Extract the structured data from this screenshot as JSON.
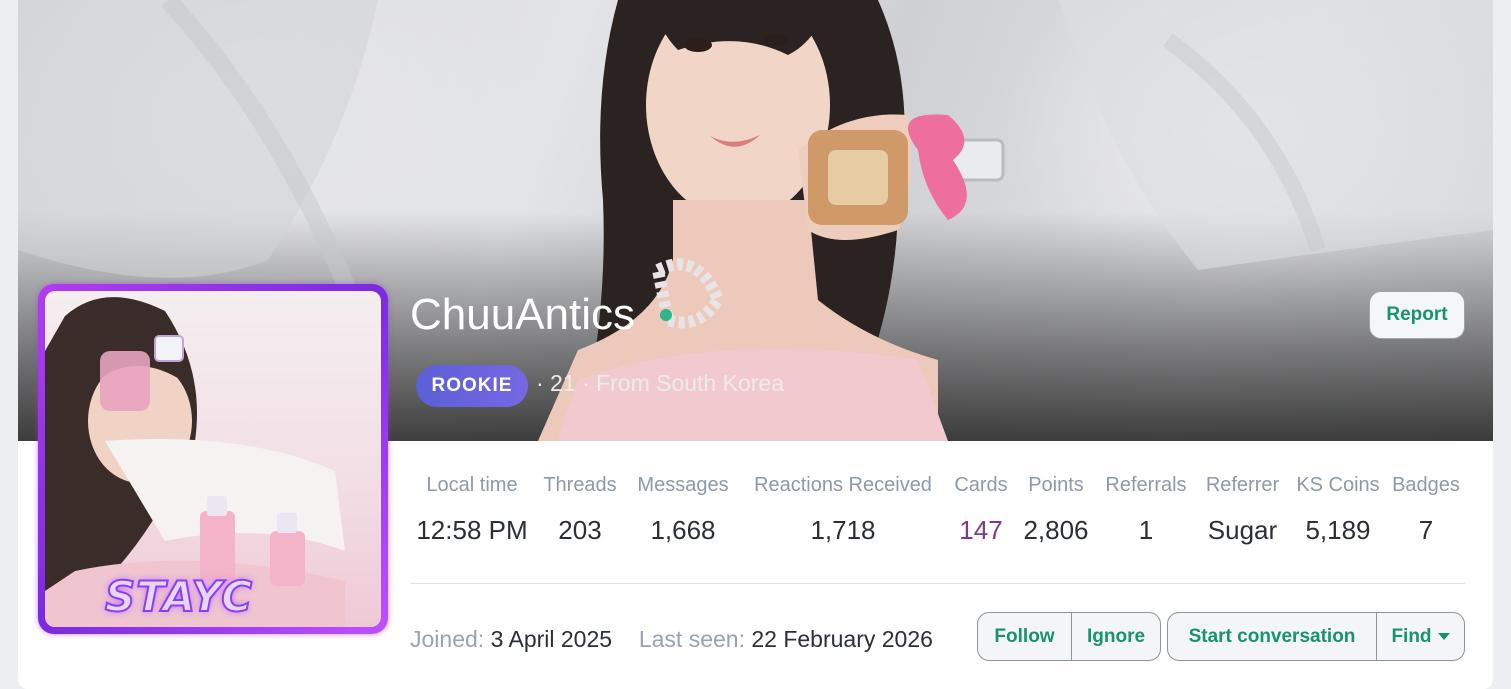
{
  "profile": {
    "username": "ChuuAntics",
    "rank_badge": "ROOKIE",
    "meta": "· 21 · From South Korea",
    "avatar_logo": "STAYC",
    "online": true
  },
  "actions": {
    "report": "Report",
    "follow": "Follow",
    "ignore": "Ignore",
    "start_conversation": "Start conversation",
    "find": "Find"
  },
  "stats": [
    {
      "label": "Local time",
      "value": "12:58 PM"
    },
    {
      "label": "Threads",
      "value": "203"
    },
    {
      "label": "Messages",
      "value": "1,668"
    },
    {
      "label": "Reactions Received",
      "value": "1,718"
    },
    {
      "label": "Cards",
      "value": "147"
    },
    {
      "label": "Points",
      "value": "2,806"
    },
    {
      "label": "Referrals",
      "value": "1"
    },
    {
      "label": "Referrer",
      "value": "Sugar"
    },
    {
      "label": "KS Coins",
      "value": "5,189"
    },
    {
      "label": "Badges",
      "value": "7"
    }
  ],
  "joined": {
    "joined_label": "Joined:",
    "joined_value": "3 April 2025",
    "last_seen_label": "Last seen:",
    "last_seen_value": "22 February 2026"
  },
  "colors": {
    "accent": "#17946f",
    "badge": "#6263d9",
    "avatar_border": "#9b3cf0",
    "online": "#2fb58a",
    "cards_value": "#7a3b8c"
  }
}
